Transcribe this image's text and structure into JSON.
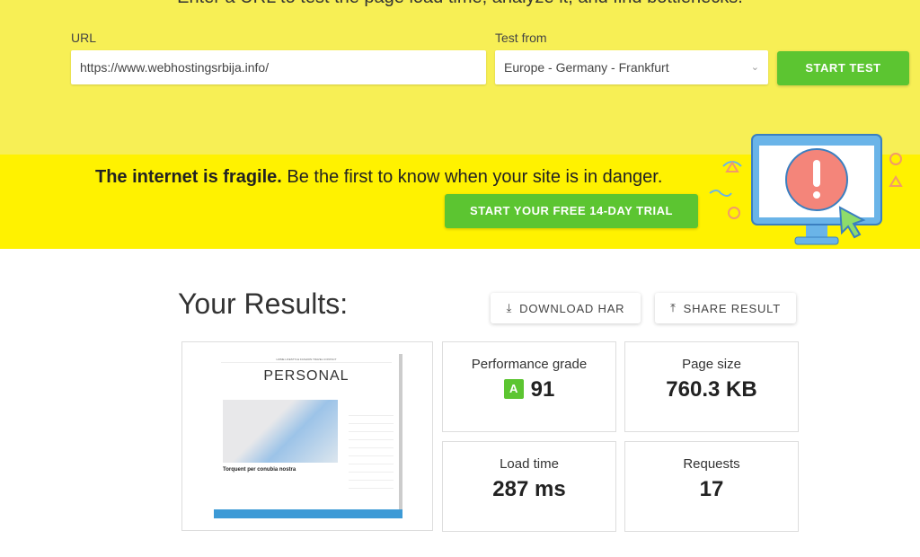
{
  "header": {
    "headline": "Enter a URL to test the page load time, analyze it, and find bottlenecks."
  },
  "form": {
    "url_label": "URL",
    "url_value": "https://www.webhostingsrbija.info/",
    "test_from_label": "Test from",
    "test_from_value": "Europe - Germany - Frankfurt",
    "start_button": "START TEST"
  },
  "promo": {
    "bold": "The internet is fragile.",
    "text": " Be the first to know when your site is in danger.",
    "trial_button": "START YOUR FREE 14-DAY TRIAL"
  },
  "results": {
    "title": "Your Results:",
    "download_button": "DOWNLOAD HAR",
    "share_button": "SHARE RESULT",
    "performance_label": "Performance grade",
    "grade": "A",
    "performance_value": "91",
    "page_size_label": "Page size",
    "page_size_value": "760.3 KB",
    "load_time_label": "Load time",
    "load_time_value": "287 ms",
    "requests_label": "Requests",
    "requests_value": "17"
  },
  "screenshot": {
    "logo": "PERSONAL",
    "post_title": "Torquent per conubia nostra"
  },
  "colors": {
    "accent": "#5cc531",
    "top_bg": "#f7ef55",
    "band_bg": "#fff200"
  }
}
